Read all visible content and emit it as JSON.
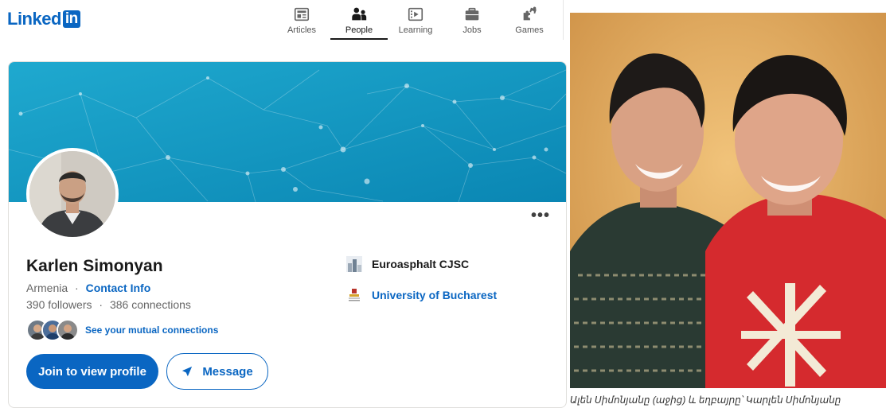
{
  "header": {
    "logo_text": "Linked",
    "logo_badge": "in",
    "nav": [
      {
        "label": "Articles",
        "icon": "articles-icon"
      },
      {
        "label": "People",
        "icon": "people-icon",
        "active": true
      },
      {
        "label": "Learning",
        "icon": "learning-icon"
      },
      {
        "label": "Jobs",
        "icon": "briefcase-icon"
      },
      {
        "label": "Games",
        "icon": "puzzle-icon"
      }
    ]
  },
  "profile": {
    "more_label": "•••",
    "name": "Karlen Simonyan",
    "location": "Armenia",
    "separator": "·",
    "contact_label": "Contact Info",
    "followers": "390 followers",
    "connections": "386 connections",
    "mutual_label": "See your mutual connections",
    "join_button": "Join to view profile",
    "message_button": "Message",
    "experience": [
      {
        "name": "Euroasphalt CJSC",
        "icon": "company-logo-icon"
      },
      {
        "name": "University of Bucharest",
        "icon": "university-logo-icon"
      }
    ]
  },
  "photo": {
    "caption": "Ալեն Սիմոնյանը (աջից) և եղբայրը՝ Կարլեն Սիմոնյանը"
  },
  "colors": {
    "brand": "#0a66c2",
    "banner_start": "#1aa3c9",
    "banner_end": "#0a8bb6"
  }
}
